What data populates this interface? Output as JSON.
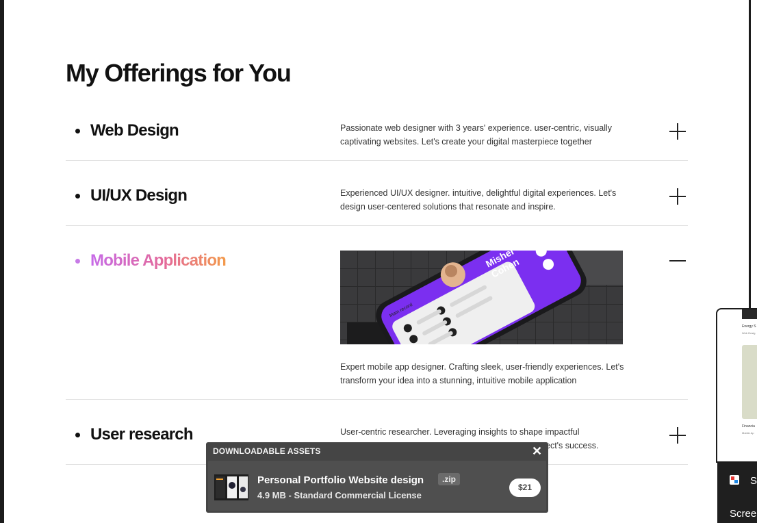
{
  "page": {
    "title": "My Offerings for You"
  },
  "offerings": [
    {
      "title": "Web Design",
      "description": "Passionate web designer with 3 years' experience. user-centric, visually captivating websites. Let's create your digital masterpiece together",
      "expanded": false,
      "toggle_icon": "plus-icon"
    },
    {
      "title": "UI/UX Design",
      "description": "Experienced UI/UX designer. intuitive, delightful digital experiences. Let's design user-centered solutions that resonate and inspire.",
      "expanded": false,
      "toggle_icon": "plus-icon"
    },
    {
      "title": "Mobile Application",
      "description": "Expert mobile app designer. Crafting sleek, user-friendly experiences. Let's transform your idea into a stunning, intuitive mobile application",
      "expanded": true,
      "toggle_icon": "minus-icon",
      "image_label": {
        "name_line1": "Mishel",
        "name_line2": "Cohen",
        "list_header": "Main record"
      }
    },
    {
      "title": "User research",
      "description": "User-centric researcher. Leveraging insights to shape impactful",
      "description_tail": "ect's success.",
      "expanded": false,
      "toggle_icon": "plus-icon"
    }
  ],
  "download_panel": {
    "heading": "DOWNLOADABLE ASSETS",
    "close_icon": "close-icon",
    "item": {
      "name": "Personal Portfolio Website design",
      "extension": ".zip",
      "meta": "4.9 MB - Standard Commercial License",
      "price": "$21"
    }
  },
  "side_window": {
    "item1_title": "Energy S",
    "item1_sub": "Web Desig",
    "item2_title": "Financia",
    "item2_sub": "Mobile Ap"
  },
  "taskbar": {
    "app_label": "S",
    "window_label": "Scree"
  },
  "colors": {
    "accent_gradient_start": "#c66ae8",
    "accent_gradient_end": "#f39a4a",
    "phone_purple": "#7b2ff0"
  }
}
